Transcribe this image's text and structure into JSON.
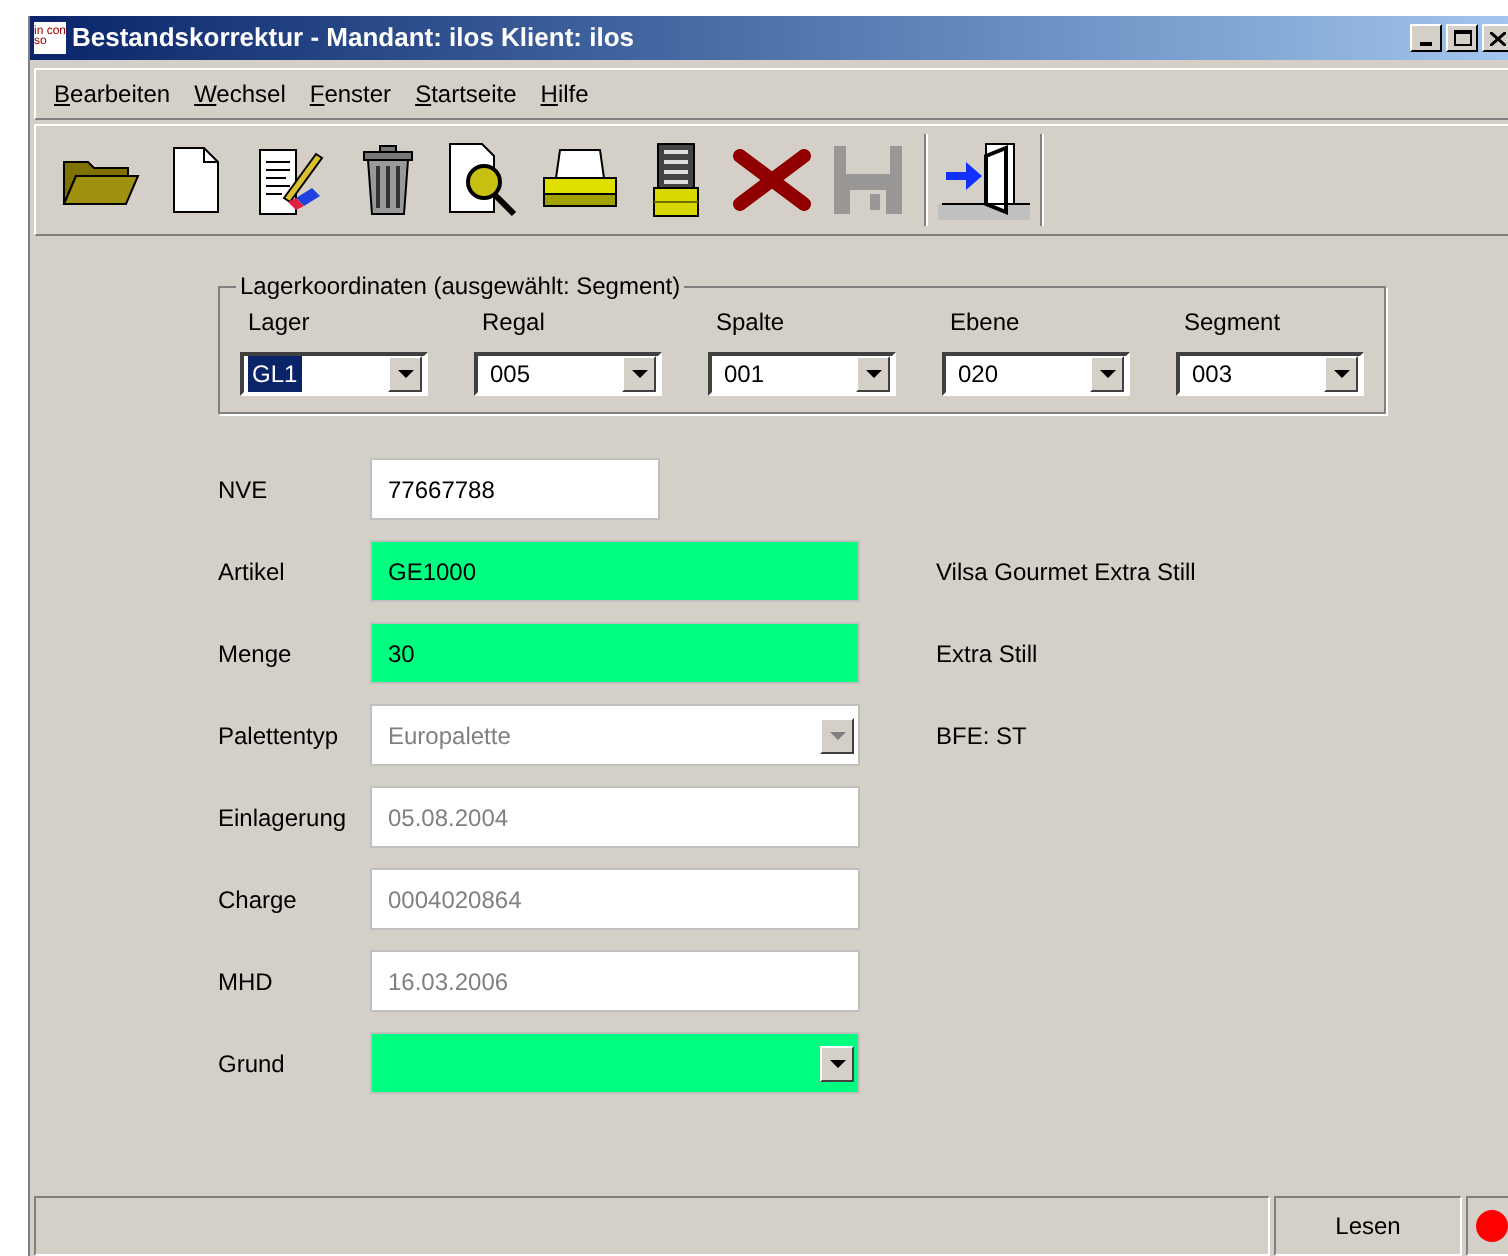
{
  "window": {
    "title": "Bestandskorrektur - Mandant: ilos Klient: ilos",
    "app_icon": "in con so"
  },
  "menu": [
    {
      "label": "Bearbeiten"
    },
    {
      "label": "Wechsel"
    },
    {
      "label": "Fenster"
    },
    {
      "label": "Startseite"
    },
    {
      "label": "Hilfe"
    }
  ],
  "toolbar": [
    {
      "kind": "open",
      "disabled": false
    },
    {
      "kind": "new",
      "disabled": false
    },
    {
      "kind": "edit",
      "disabled": false
    },
    {
      "kind": "delete",
      "disabled": false
    },
    {
      "kind": "preview",
      "disabled": false
    },
    {
      "kind": "print",
      "disabled": false
    },
    {
      "kind": "scanner",
      "disabled": false
    },
    {
      "kind": "cancel",
      "disabled": false
    },
    {
      "kind": "save",
      "disabled": true
    },
    {
      "kind": "exit",
      "disabled": false
    }
  ],
  "coordinates": {
    "title": "Lagerkoordinaten (ausgewählt: Segment)",
    "items": [
      {
        "label": "Lager",
        "value": "GL1",
        "selected": true
      },
      {
        "label": "Regal",
        "value": "005",
        "selected": false
      },
      {
        "label": "Spalte",
        "value": "001",
        "selected": false
      },
      {
        "label": "Ebene",
        "value": "020",
        "selected": false
      },
      {
        "label": "Segment",
        "value": "003",
        "selected": false
      }
    ]
  },
  "fields": [
    {
      "label": "NVE",
      "kind": "short_text",
      "value": "77667788",
      "highlighted": false,
      "disabled": false
    },
    {
      "label": "Artikel",
      "kind": "text",
      "value": "GE1000",
      "highlighted": true,
      "disabled": false,
      "info": "Vilsa Gourmet Extra Still"
    },
    {
      "label": "Menge",
      "kind": "text",
      "value": "30",
      "highlighted": true,
      "disabled": false,
      "info": "Extra Still"
    },
    {
      "label": "Palettentyp",
      "kind": "combo",
      "value": "Europalette",
      "highlighted": false,
      "disabled": true,
      "info": "BFE: ST"
    },
    {
      "label": "Einlagerung",
      "kind": "text",
      "value": "05.08.2004",
      "highlighted": false,
      "disabled": true
    },
    {
      "label": "Charge",
      "kind": "text",
      "value": "0004020864",
      "highlighted": false,
      "disabled": true
    },
    {
      "label": "MHD",
      "kind": "text",
      "value": "16.03.2006",
      "highlighted": false,
      "disabled": true
    },
    {
      "label": "Grund",
      "kind": "combo",
      "highlighted": true,
      "disabled": false
    }
  ],
  "status_bar": {
    "mode": "Lesen",
    "indicator": {
      "color": "#ff0000"
    }
  }
}
